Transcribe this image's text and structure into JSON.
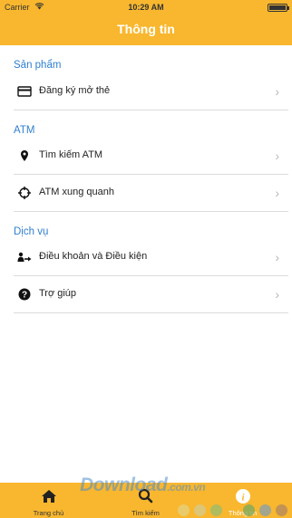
{
  "status_bar": {
    "carrier": "Carrier",
    "time": "10:29 AM"
  },
  "nav": {
    "title": "Thông tin"
  },
  "sections": [
    {
      "header": "Sản phẩm",
      "items": [
        {
          "label": "Đăng ký mở thẻ",
          "icon": "card-icon"
        }
      ]
    },
    {
      "header": "ATM",
      "items": [
        {
          "label": "Tìm kiếm ATM",
          "icon": "location-pin-icon"
        },
        {
          "label": "ATM xung quanh",
          "icon": "crosshair-icon"
        }
      ]
    },
    {
      "header": "Dịch vụ",
      "items": [
        {
          "label": "Điều khoản và Điều kiện",
          "icon": "terms-icon"
        },
        {
          "label": "Trợ giúp",
          "icon": "help-icon"
        }
      ]
    }
  ],
  "tabs": [
    {
      "label": "Trang chủ",
      "icon": "home-icon",
      "active": false
    },
    {
      "label": "Tìm kiếm",
      "icon": "search-icon",
      "active": false
    },
    {
      "label": "Thông tin",
      "icon": "info-icon",
      "active": true
    }
  ],
  "watermark": "Download.com.vn",
  "colors": {
    "accent": "#f8b72e",
    "section_header": "#2f7fd0",
    "divider": "#dcdcdc",
    "chevron": "#b8b8b8"
  }
}
